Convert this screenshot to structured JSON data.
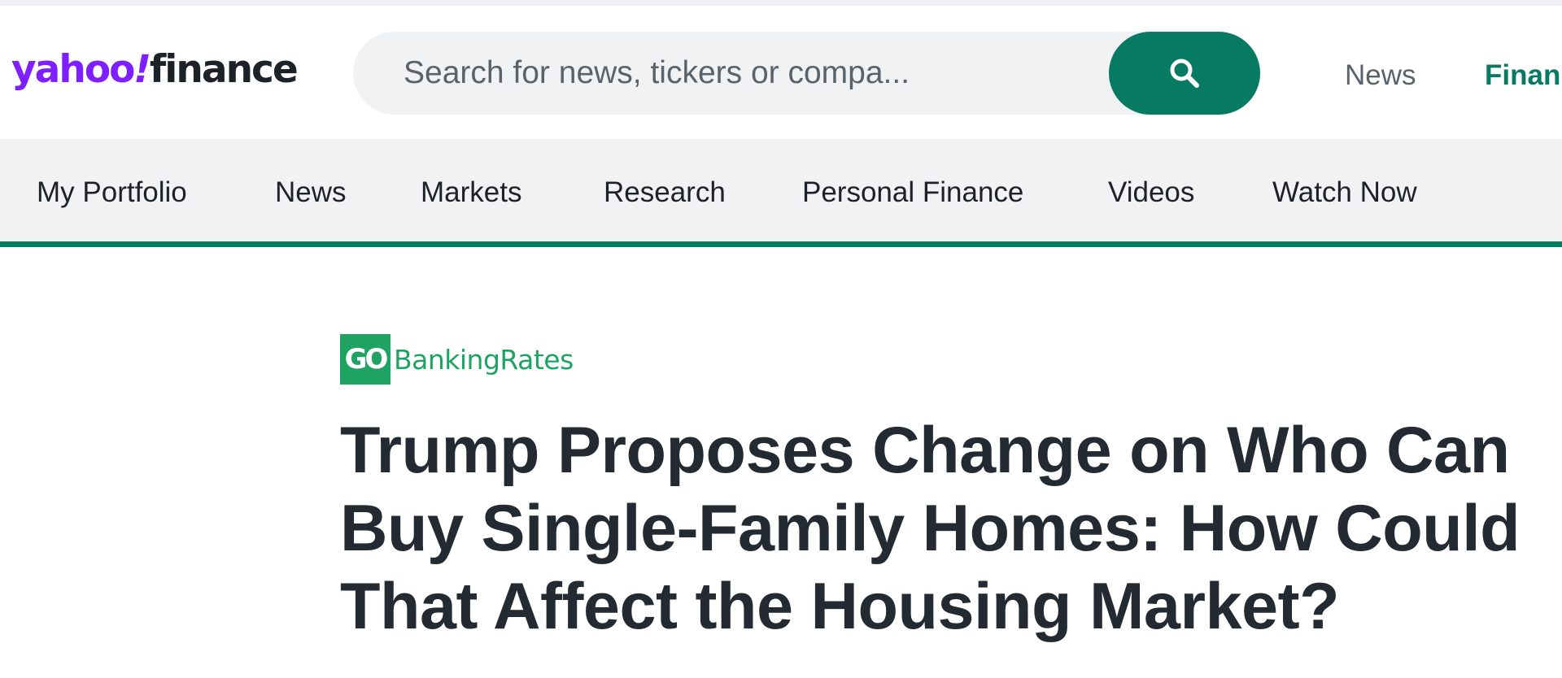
{
  "header": {
    "logo": {
      "part1": "yahoo",
      "part2": "!",
      "part3": "finance"
    },
    "search": {
      "placeholder": "Search for news, tickers or compa...",
      "button_icon": "search-icon"
    },
    "links": [
      "News",
      "Finan"
    ]
  },
  "nav": {
    "items": [
      "My Portfolio",
      "News",
      "Markets",
      "Research",
      "Personal Finance",
      "Videos",
      "Watch Now"
    ]
  },
  "article": {
    "provider": {
      "badge": "GO",
      "name": "BankingRates"
    },
    "headline_lines": [
      "Trump Proposes Change on Who Can",
      "Buy Single-Family Homes: How Could",
      "That Affect the Housing Market?"
    ]
  },
  "colors": {
    "brand_purple": "#7e1fff",
    "accent_green": "#077a63",
    "provider_green": "#1ea362",
    "nav_background": "#f0f2f4"
  }
}
